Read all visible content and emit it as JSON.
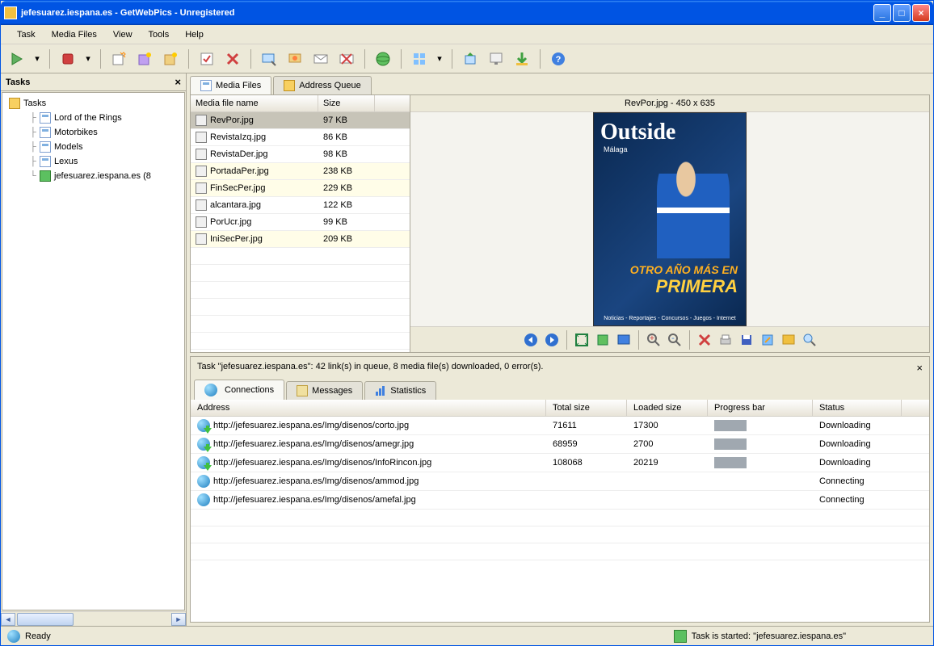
{
  "window": {
    "title": "jefesuarez.iespana.es - GetWebPics - Unregistered"
  },
  "menu": {
    "task": "Task",
    "media": "Media Files",
    "view": "View",
    "tools": "Tools",
    "help": "Help"
  },
  "sidebar": {
    "title": "Tasks",
    "root": "Tasks",
    "items": [
      {
        "label": "Lord of the Rings"
      },
      {
        "label": "Motorbikes"
      },
      {
        "label": "Models"
      },
      {
        "label": "Lexus"
      },
      {
        "label": "jefesuarez.iespana.es (8"
      }
    ]
  },
  "top_tabs": {
    "media": "Media Files",
    "queue": "Address Queue"
  },
  "file_grid": {
    "col_name": "Media file name",
    "col_size": "Size",
    "rows": [
      {
        "name": "RevPor.jpg",
        "size": "97 KB",
        "sel": true
      },
      {
        "name": "RevistaIzq.jpg",
        "size": "86 KB"
      },
      {
        "name": "RevistaDer.jpg",
        "size": "98 KB"
      },
      {
        "name": "PortadaPer.jpg",
        "size": "238 KB",
        "hl": true
      },
      {
        "name": "FinSecPer.jpg",
        "size": "229 KB",
        "hl": true
      },
      {
        "name": "alcantara.jpg",
        "size": "122 KB"
      },
      {
        "name": "PorUcr.jpg",
        "size": "99 KB"
      },
      {
        "name": "IniSecPer.jpg",
        "size": "209 KB",
        "hl": true
      }
    ]
  },
  "preview": {
    "title": "RevPor.jpg - 450 x 635",
    "mag_title": "Outside",
    "mag_sub": "Málaga",
    "mag_line1": "OTRO AÑO MÁS EN",
    "mag_line2": "PRIMERA",
    "mag_footer": "Noticias - Reportajes - Concursos - Juegos - Internet"
  },
  "task_bar": {
    "text": "Task \"jefesuarez.iespana.es\":    42 link(s) in queue,    8 media file(s) downloaded,    0 error(s)."
  },
  "bottom_tabs": {
    "conn": "Connections",
    "msg": "Messages",
    "stat": "Statistics"
  },
  "conn_grid": {
    "col_addr": "Address",
    "col_total": "Total size",
    "col_loaded": "Loaded size",
    "col_prog": "Progress bar",
    "col_status": "Status",
    "rows": [
      {
        "addr": "http://jefesuarez.iespana.es/Img/disenos/corto.jpg",
        "total": "71611",
        "loaded": "17300",
        "prog": true,
        "status": "Downloading",
        "dl": true
      },
      {
        "addr": "http://jefesuarez.iespana.es/Img/disenos/amegr.jpg",
        "total": "68959",
        "loaded": "2700",
        "prog": true,
        "status": "Downloading",
        "dl": true
      },
      {
        "addr": "http://jefesuarez.iespana.es/Img/disenos/InfoRincon.jpg",
        "total": "108068",
        "loaded": "20219",
        "prog": true,
        "status": "Downloading",
        "dl": true
      },
      {
        "addr": "http://jefesuarez.iespana.es/Img/disenos/ammod.jpg",
        "total": "",
        "loaded": "",
        "prog": false,
        "status": "Connecting",
        "dl": false
      },
      {
        "addr": "http://jefesuarez.iespana.es/Img/disenos/amefal.jpg",
        "total": "",
        "loaded": "",
        "prog": false,
        "status": "Connecting",
        "dl": false
      }
    ]
  },
  "status": {
    "ready": "Ready",
    "task": "Task is started: \"jefesuarez.iespana.es\""
  }
}
